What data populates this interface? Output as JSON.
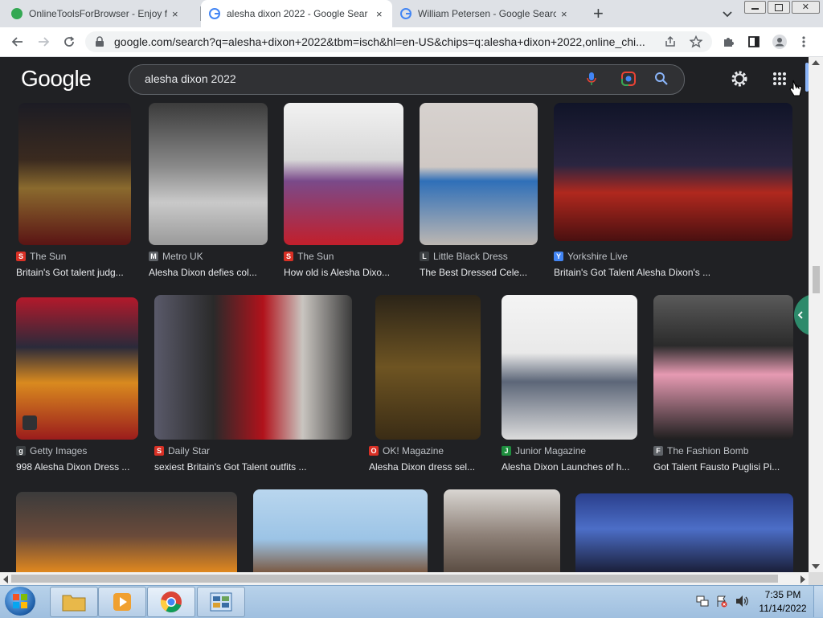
{
  "browser": {
    "tabs": [
      {
        "title": "OnlineToolsForBrowser - Enjoy fr",
        "close": "×"
      },
      {
        "title": "alesha dixon 2022 - Google Sear",
        "close": "×"
      },
      {
        "title": "William Petersen - Google Search",
        "close": "×"
      }
    ],
    "new_tab": "+",
    "url": "google.com/search?q=alesha+dixon+2022&tbm=isch&hl=en-US&chips=q:alesha+dixon+2022,online_chi..."
  },
  "google": {
    "logo": "Google",
    "query": "alesha dixon 2022"
  },
  "results": [
    {
      "source": "The Sun",
      "caption": "Britain's Got talent judg...",
      "icon_color": "#d93025",
      "icon_letter": "S"
    },
    {
      "source": "Metro UK",
      "caption": "Alesha Dixon defies col...",
      "icon_color": "#5f6368",
      "icon_letter": "M"
    },
    {
      "source": "The Sun",
      "caption": "How old is Alesha Dixo...",
      "icon_color": "#d93025",
      "icon_letter": "S"
    },
    {
      "source": "Little Black Dress",
      "caption": "The Best Dressed Cele...",
      "icon_color": "#3c4043",
      "icon_letter": "L"
    },
    {
      "source": "Yorkshire Live",
      "caption": "Britain's Got Talent Alesha Dixon's ...",
      "icon_color": "#4285f4",
      "icon_letter": "Y"
    },
    {
      "source": "Getty Images",
      "caption": "998 Alesha Dixon Dress ...",
      "icon_color": "#3c4043",
      "icon_letter": "g"
    },
    {
      "source": "Daily Star",
      "caption": "sexiest Britain's Got Talent outfits ...",
      "icon_color": "#d93025",
      "icon_letter": "S"
    },
    {
      "source": "OK! Magazine",
      "caption": "Alesha Dixon dress sel...",
      "icon_color": "#d93025",
      "icon_letter": "O"
    },
    {
      "source": "Junior Magazine",
      "caption": "Alesha Dixon Launches of h...",
      "icon_color": "#1e8e3e",
      "icon_letter": "J"
    },
    {
      "source": "The Fashion Bomb",
      "caption": "Got Talent Fausto Puglisi Pi...",
      "icon_color": "#5f6368",
      "icon_letter": "F"
    }
  ],
  "taskbar": {
    "time": "7:35 PM",
    "date": "11/14/2022"
  }
}
